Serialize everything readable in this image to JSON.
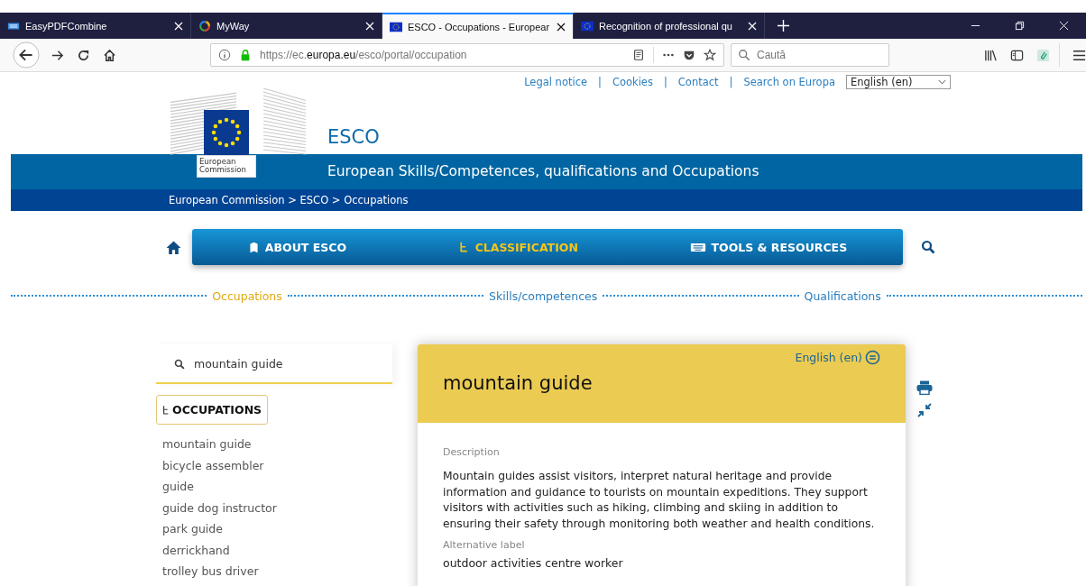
{
  "browser": {
    "tabs": [
      {
        "title": "EasyPDFCombine",
        "selected": false
      },
      {
        "title": "MyWay",
        "selected": false
      },
      {
        "title": "ESCO - Occupations - Europear",
        "selected": true
      },
      {
        "title": "Recognition of professional qu",
        "selected": false
      }
    ],
    "url": {
      "prefix": "https://ec.",
      "domain": "europa.eu",
      "path": "/esco/portal/occupation"
    },
    "search": {
      "placeholder": "Caută"
    }
  },
  "page": {
    "top_links": [
      "Legal notice",
      "Cookies",
      "Contact",
      "Search on Europa"
    ],
    "top_link_separators": [
      "|",
      "|",
      "|"
    ],
    "language_select": "English (en)",
    "logo_label": [
      "European",
      "Commission"
    ],
    "site_title": "ESCO",
    "site_subtitle": "European Skills/Competences, qualifications and Occupations",
    "breadcrumb": "European Commission > ESCO > Occupations",
    "nav": [
      {
        "label": "ABOUT ESCO",
        "selected": false
      },
      {
        "label": "CLASSIFICATION",
        "selected": true
      },
      {
        "label": "TOOLS & RESOURCES",
        "selected": false
      }
    ],
    "subnav": [
      {
        "label": "Occupations",
        "selected": true
      },
      {
        "label": "Skills/competences",
        "selected": false
      },
      {
        "label": "Qualifications",
        "selected": false
      }
    ],
    "search_value": "mountain guide",
    "occupations_button": "OCCUPATIONS",
    "results": [
      "mountain guide",
      "bicycle assembler",
      "guide",
      "guide dog instructor",
      "park guide",
      "derrickhand",
      "trolley bus driver"
    ],
    "card": {
      "language": "English (en)",
      "title": "mountain guide",
      "description_label": "Description",
      "description": "Mountain guides assist visitors, interpret natural heritage and provide information and guidance to tourists on mountain expeditions. They support visitors with activities such as hiking, climbing and skiing in addition to ensuring their safety through monitoring both weather and health conditions.",
      "alt_label": "Alternative label",
      "alt_value": "outdoor activities centre worker"
    }
  }
}
